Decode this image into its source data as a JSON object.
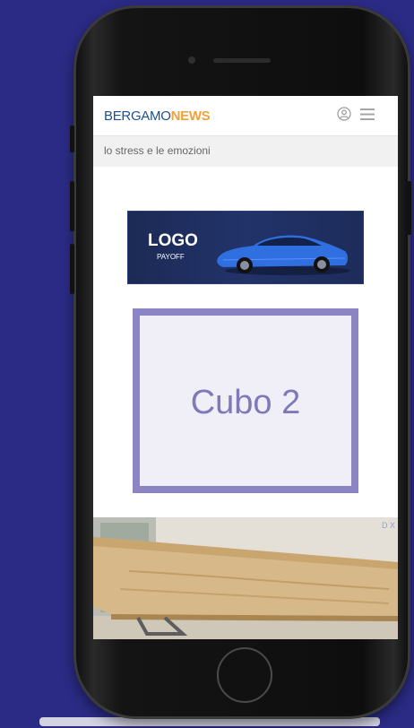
{
  "header": {
    "brand_part1": "BERGAMO",
    "brand_part2": "NEWS"
  },
  "breadcrumb": {
    "text": "lo stress e le emozioni"
  },
  "banner": {
    "logo": "LOGO",
    "payoff": "PAYOFF"
  },
  "cube": {
    "label": "Cubo 2"
  },
  "ad": {
    "badge": "D X"
  },
  "colors": {
    "background": "#2b2b86",
    "brand_blue": "#1f4f8f",
    "brand_orange": "#f0a23a",
    "cube_border": "#8b86c3",
    "cube_text": "#7e79b9"
  },
  "icons": {
    "user": "user-icon",
    "menu": "menu-icon"
  }
}
